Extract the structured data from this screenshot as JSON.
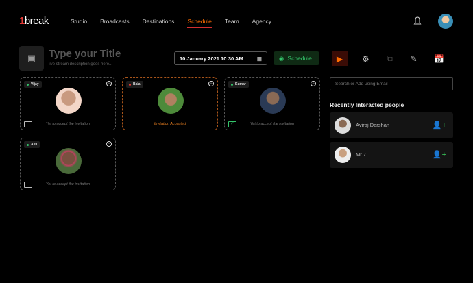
{
  "brand": {
    "logo": "1break"
  },
  "nav": {
    "items": [
      "Studio",
      "Broadcasts",
      "Destinations",
      "Schedule",
      "Team",
      "Agency"
    ],
    "active": "Schedule"
  },
  "header": {
    "title_placeholder": "Type your Title",
    "description_placeholder": "live stream description goes here...",
    "datetime": "10 January 2021 10:30 AM",
    "schedule_label": "Schedule"
  },
  "participants": [
    {
      "name": "Vijay",
      "online": true,
      "status": "Yet to accept the invitation",
      "accepted": false
    },
    {
      "name": "Bala",
      "online": false,
      "status": "Invitation Accepted",
      "accepted": true
    },
    {
      "name": "Kumar",
      "online": true,
      "status": "Yet to accept the invitation",
      "accepted": false
    },
    {
      "name": "Akil",
      "online": true,
      "status": "Yet to accept the invitation",
      "accepted": false
    }
  ],
  "sidebar": {
    "search_placeholder": "Search or Add using Email",
    "recent_heading": "Recently Interacted people",
    "people": [
      {
        "name": "Aviraj Darshan"
      },
      {
        "name": "Mr 7"
      }
    ]
  },
  "colors": {
    "accent": "#ff6d00",
    "green": "#33c36a",
    "red": "#e53935"
  }
}
